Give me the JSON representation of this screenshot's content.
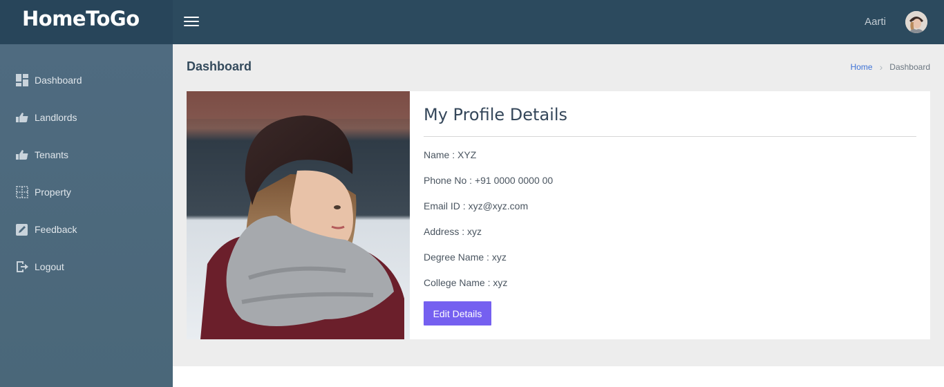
{
  "app": {
    "brand": "HomeToGo"
  },
  "header": {
    "user_name": "Aarti"
  },
  "sidebar": {
    "items": [
      {
        "label": "Dashboard",
        "icon": "dashboard-icon"
      },
      {
        "label": "Landlords",
        "icon": "thumbs-up-icon"
      },
      {
        "label": "Tenants",
        "icon": "thumbs-up-icon"
      },
      {
        "label": "Property",
        "icon": "grid-icon"
      },
      {
        "label": "Feedback",
        "icon": "edit-icon"
      },
      {
        "label": "Logout",
        "icon": "logout-icon"
      }
    ]
  },
  "page": {
    "title": "Dashboard",
    "breadcrumb": {
      "home": "Home",
      "current": "Dashboard"
    }
  },
  "profile": {
    "title": "My Profile Details",
    "fields": [
      "Name : XYZ",
      "Phone No : +91 0000 0000 00",
      "Email ID : xyz@xyz.com",
      "Address : xyz",
      "Degree Name : xyz",
      "College Name : xyz"
    ],
    "edit_label": "Edit Details"
  },
  "colors": {
    "topbar": "#2c4a5e",
    "sidebar": "#4f6b80",
    "accent": "#7560f0",
    "link": "#3f73d6"
  }
}
